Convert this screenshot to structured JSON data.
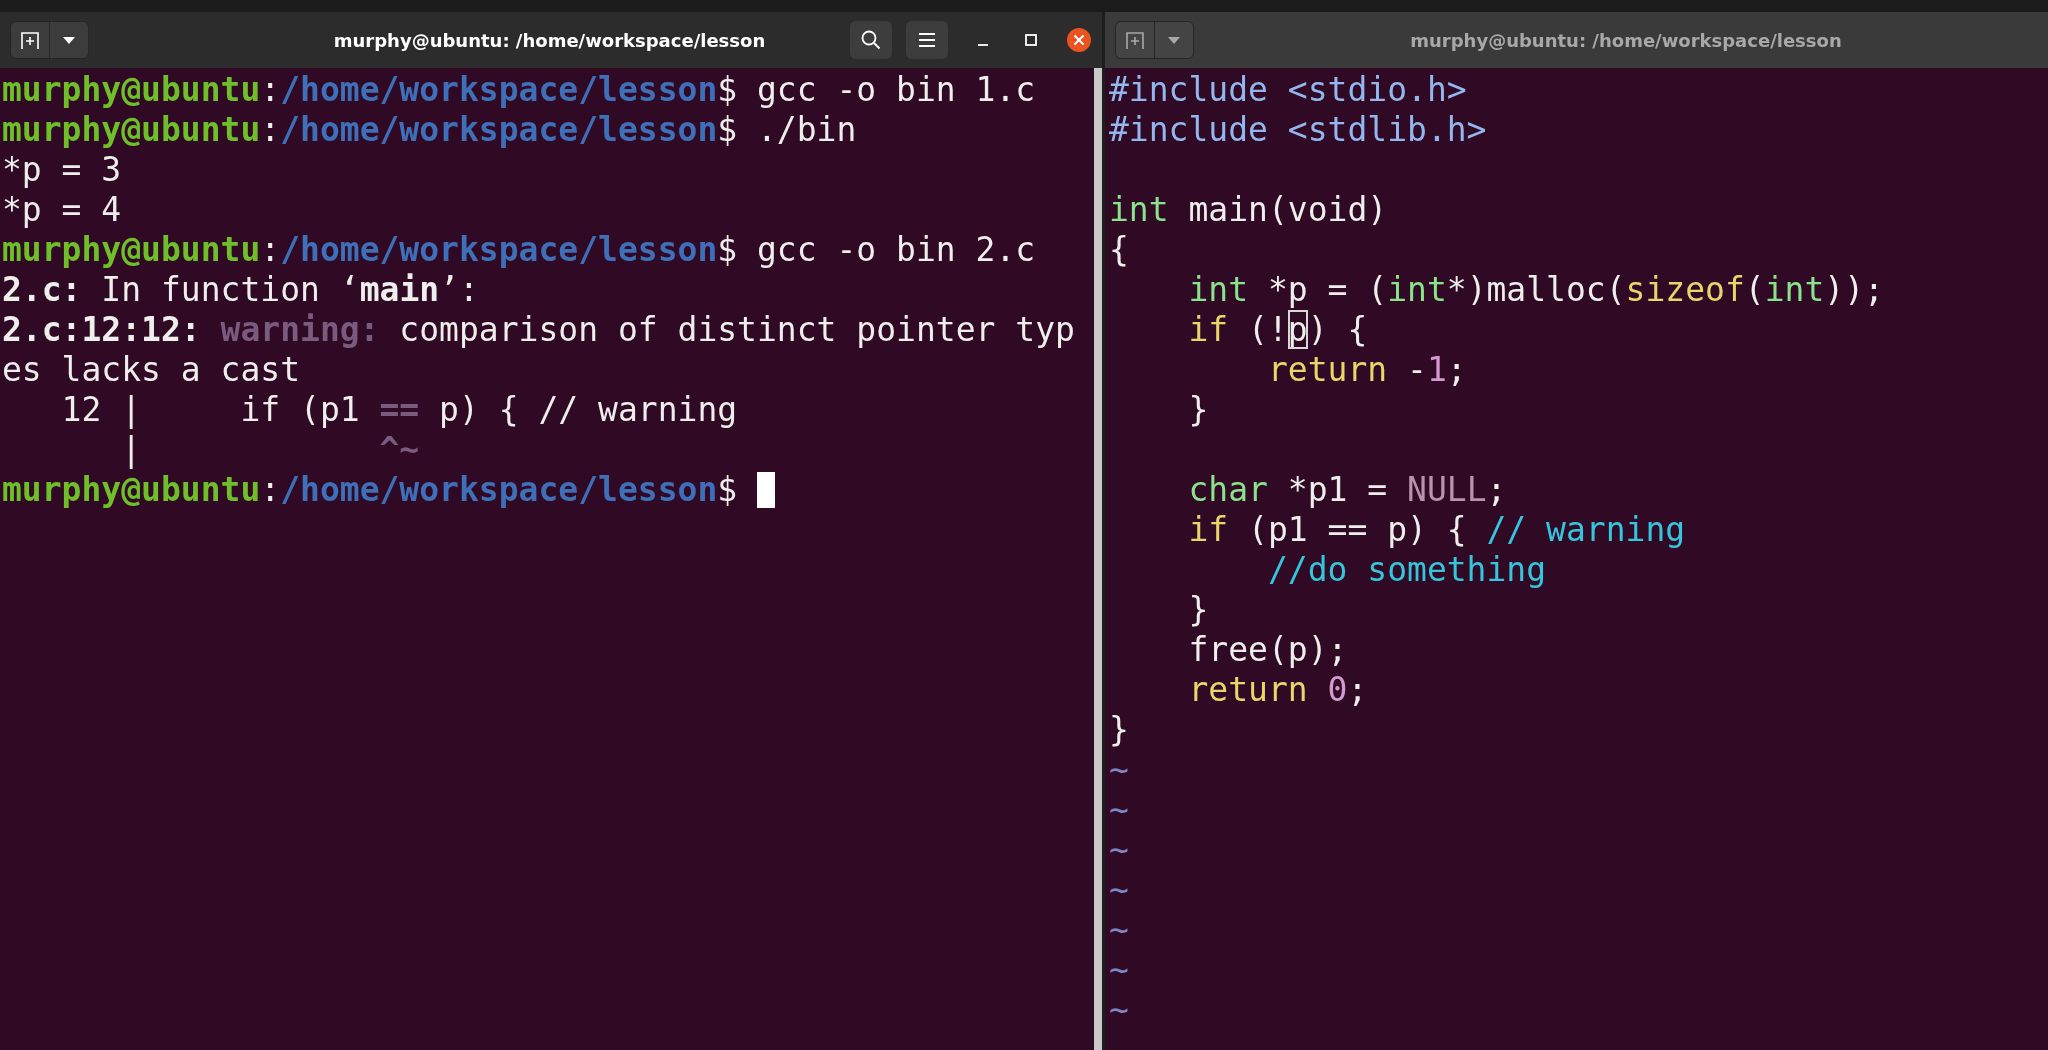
{
  "windows": [
    {
      "title": "murphy@ubuntu: /home/workspace/lesson",
      "focused": true,
      "controls_visible": true,
      "lines": [
        {
          "segments": [
            {
              "kind": "user",
              "text": "murphy@ubuntu"
            },
            {
              "kind": "plain",
              "text": ":"
            },
            {
              "kind": "path",
              "text": "/home/workspace/lesson"
            },
            {
              "kind": "plain",
              "text": "$ gcc -o bin 1.c"
            }
          ]
        },
        {
          "segments": [
            {
              "kind": "user",
              "text": "murphy@ubuntu"
            },
            {
              "kind": "plain",
              "text": ":"
            },
            {
              "kind": "path",
              "text": "/home/workspace/lesson"
            },
            {
              "kind": "plain",
              "text": "$ ./bin"
            }
          ]
        },
        {
          "segments": [
            {
              "kind": "plain",
              "text": "*p = 3"
            }
          ]
        },
        {
          "segments": [
            {
              "kind": "plain",
              "text": "*p = 4"
            }
          ]
        },
        {
          "segments": [
            {
              "kind": "user",
              "text": "murphy@ubuntu"
            },
            {
              "kind": "plain",
              "text": ":"
            },
            {
              "kind": "path",
              "text": "/home/workspace/lesson"
            },
            {
              "kind": "plain",
              "text": "$ gcc -o bin 2.c"
            }
          ]
        },
        {
          "segments": [
            {
              "kind": "bold",
              "text": "2.c:"
            },
            {
              "kind": "plain",
              "text": " In function ‘"
            },
            {
              "kind": "bold",
              "text": "main"
            },
            {
              "kind": "plain",
              "text": "’:"
            }
          ]
        },
        {
          "segments": [
            {
              "kind": "bold",
              "text": "2.c:12:12: "
            },
            {
              "kind": "warning",
              "text": "warning:"
            },
            {
              "kind": "plain",
              "text": " comparison of distinct pointer typ"
            }
          ]
        },
        {
          "segments": [
            {
              "kind": "plain",
              "text": "es lacks a cast"
            }
          ]
        },
        {
          "segments": [
            {
              "kind": "plain",
              "text": "   12 |     if (p1 "
            },
            {
              "kind": "warning",
              "text": "=="
            },
            {
              "kind": "plain",
              "text": " p) { // warning"
            }
          ]
        },
        {
          "segments": [
            {
              "kind": "plain",
              "text": "      |            "
            },
            {
              "kind": "warning",
              "text": "^~"
            }
          ]
        },
        {
          "segments": [
            {
              "kind": "user",
              "text": "murphy@ubuntu"
            },
            {
              "kind": "plain",
              "text": ":"
            },
            {
              "kind": "path",
              "text": "/home/workspace/lesson"
            },
            {
              "kind": "plain",
              "text": "$"
            }
          ],
          "cursor": true
        }
      ]
    },
    {
      "title": "murphy@ubuntu: /home/workspace/lesson",
      "focused": false,
      "controls_visible": false,
      "lines": [
        {
          "segments": [
            {
              "kind": "include",
              "text": "#include <stdio.h>"
            }
          ]
        },
        {
          "segments": [
            {
              "kind": "include",
              "text": "#include <stdlib.h>"
            }
          ]
        },
        {
          "blank": true
        },
        {
          "segments": [
            {
              "kind": "type",
              "text": "int"
            },
            {
              "kind": "plain",
              "text": " main(void)"
            }
          ]
        },
        {
          "segments": [
            {
              "kind": "plain",
              "text": "{"
            }
          ]
        },
        {
          "segments": [
            {
              "kind": "type",
              "text": "    int"
            },
            {
              "kind": "plain",
              "text": " *p = ("
            },
            {
              "kind": "type",
              "text": "int"
            },
            {
              "kind": "plain",
              "text": "*)malloc("
            },
            {
              "kind": "keyword",
              "text": "sizeof"
            },
            {
              "kind": "plain",
              "text": "("
            },
            {
              "kind": "type",
              "text": "int"
            },
            {
              "kind": "plain",
              "text": "));"
            }
          ]
        },
        {
          "segments": [
            {
              "kind": "keyword",
              "text": "    if"
            },
            {
              "kind": "plain",
              "text": " (!"
            },
            {
              "kind": "boxed",
              "text": "p"
            },
            {
              "kind": "plain",
              "text": ") {"
            }
          ]
        },
        {
          "segments": [
            {
              "kind": "keyword",
              "text": "        return"
            },
            {
              "kind": "plain",
              "text": " -"
            },
            {
              "kind": "number",
              "text": "1"
            },
            {
              "kind": "plain",
              "text": ";"
            }
          ]
        },
        {
          "segments": [
            {
              "kind": "plain",
              "text": "    }"
            }
          ]
        },
        {
          "blank": true
        },
        {
          "segments": [
            {
              "kind": "type",
              "text": "    char"
            },
            {
              "kind": "plain",
              "text": " *p1 = "
            },
            {
              "kind": "constant",
              "text": "NULL"
            },
            {
              "kind": "plain",
              "text": ";"
            }
          ]
        },
        {
          "segments": [
            {
              "kind": "keyword",
              "text": "    if"
            },
            {
              "kind": "plain",
              "text": " (p1 == p) { "
            },
            {
              "kind": "comment",
              "text": "// warning"
            }
          ]
        },
        {
          "segments": [
            {
              "kind": "comment",
              "text": "        //do something"
            }
          ]
        },
        {
          "segments": [
            {
              "kind": "plain",
              "text": "    }"
            }
          ]
        },
        {
          "segments": [
            {
              "kind": "plain",
              "text": "    free(p);"
            }
          ]
        },
        {
          "segments": [
            {
              "kind": "keyword",
              "text": "    return "
            },
            {
              "kind": "number",
              "text": "0"
            },
            {
              "kind": "plain",
              "text": ";"
            }
          ]
        },
        {
          "segments": [
            {
              "kind": "plain",
              "text": "}"
            }
          ]
        },
        {
          "segments": [
            {
              "kind": "tilde",
              "text": "~"
            }
          ]
        },
        {
          "segments": [
            {
              "kind": "tilde",
              "text": "~"
            }
          ]
        },
        {
          "segments": [
            {
              "kind": "tilde",
              "text": "~"
            }
          ]
        },
        {
          "segments": [
            {
              "kind": "tilde",
              "text": "~"
            }
          ]
        },
        {
          "segments": [
            {
              "kind": "tilde",
              "text": "~"
            }
          ]
        },
        {
          "segments": [
            {
              "kind": "tilde",
              "text": "~"
            }
          ]
        },
        {
          "segments": [
            {
              "kind": "tilde",
              "text": "~"
            }
          ]
        }
      ]
    }
  ]
}
